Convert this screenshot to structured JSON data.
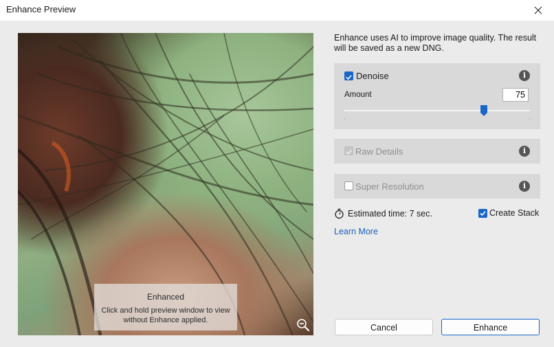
{
  "window": {
    "title": "Enhance Preview"
  },
  "preview": {
    "overlay_title": "Enhanced",
    "overlay_subtitle": "Click and hold preview window to view without Enhance applied.",
    "zoom_icon": "zoom-out-icon"
  },
  "intro_text": "Enhance uses AI to improve image quality. The result will be saved as a new DNG.",
  "denoise": {
    "label": "Denoise",
    "checked": true,
    "amount_label": "Amount",
    "amount_value": "75",
    "slider_fraction": 0.75
  },
  "raw_details": {
    "label": "Raw Details",
    "checked": true,
    "disabled": true
  },
  "super_resolution": {
    "label": "Super Resolution",
    "checked": false,
    "disabled": true
  },
  "estimate": {
    "text": "Estimated time: 7 sec."
  },
  "create_stack": {
    "label": "Create Stack",
    "checked": true
  },
  "learn_more": "Learn More",
  "buttons": {
    "cancel": "Cancel",
    "enhance": "Enhance"
  },
  "colors": {
    "accent": "#1a66c8",
    "link": "#1a5fb4"
  }
}
